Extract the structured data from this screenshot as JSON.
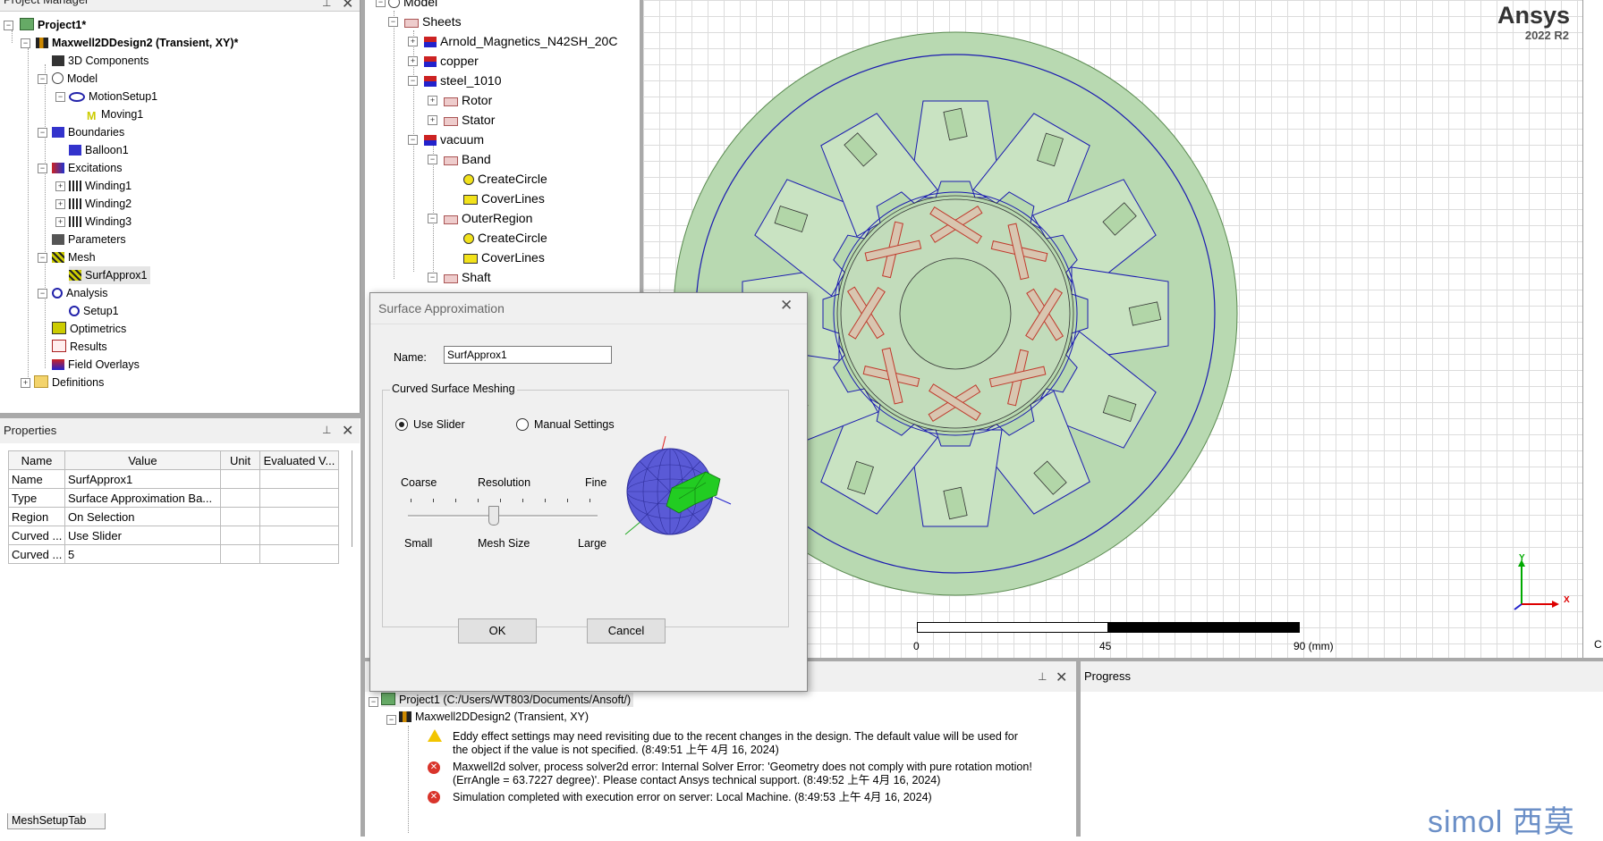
{
  "project_manager": {
    "title": "Project Manager",
    "items": [
      {
        "label": "Project1*",
        "bold": true
      },
      {
        "label": "Maxwell2DDesign2 (Transient, XY)*",
        "bold": true
      },
      {
        "label": "3D Components"
      },
      {
        "label": "Model"
      },
      {
        "label": "MotionSetup1"
      },
      {
        "label": "Moving1"
      },
      {
        "label": "Boundaries"
      },
      {
        "label": "Balloon1"
      },
      {
        "label": "Excitations"
      },
      {
        "label": "Winding1"
      },
      {
        "label": "Winding2"
      },
      {
        "label": "Winding3"
      },
      {
        "label": "Parameters"
      },
      {
        "label": "Mesh"
      },
      {
        "label": "SurfApprox1"
      },
      {
        "label": "Analysis"
      },
      {
        "label": "Setup1"
      },
      {
        "label": "Optimetrics"
      },
      {
        "label": "Results"
      },
      {
        "label": "Field Overlays"
      },
      {
        "label": "Definitions"
      }
    ]
  },
  "properties": {
    "title": "Properties",
    "headers": [
      "Name",
      "Value",
      "Unit",
      "Evaluated V..."
    ],
    "rows": [
      [
        "Name",
        "SurfApprox1",
        "",
        ""
      ],
      [
        "Type",
        "Surface Approximation Ba...",
        "",
        ""
      ],
      [
        "Region",
        "On Selection",
        "",
        ""
      ],
      [
        "Curved ...",
        "Use Slider",
        "",
        ""
      ],
      [
        "Curved ...",
        "5",
        "",
        ""
      ]
    ],
    "tab": "MeshSetupTab"
  },
  "model_tree": {
    "items": [
      {
        "label": "Model"
      },
      {
        "label": "Sheets"
      },
      {
        "label": "Arnold_Magnetics_N42SH_20C"
      },
      {
        "label": "copper"
      },
      {
        "label": "steel_1010"
      },
      {
        "label": "Rotor"
      },
      {
        "label": "Stator"
      },
      {
        "label": "vacuum"
      },
      {
        "label": "Band"
      },
      {
        "label": "CreateCircle"
      },
      {
        "label": "CoverLines"
      },
      {
        "label": "OuterRegion"
      },
      {
        "label": "CreateCircle"
      },
      {
        "label": "CoverLines"
      },
      {
        "label": "Shaft"
      }
    ]
  },
  "viewport": {
    "brand": "Ansys",
    "version": "2022 R2",
    "scale_labels": [
      "0",
      "45",
      "90 (mm)"
    ],
    "axis_y": "Y",
    "axis_x": "X",
    "right_edge_text": "C"
  },
  "dialog": {
    "title": "Surface Approximation",
    "name_label": "Name:",
    "name_value": "SurfApprox1",
    "group_label": "Curved Surface Meshing",
    "radio_slider": "Use Slider",
    "radio_manual": "Manual Settings",
    "selected": "slider",
    "coarse": "Coarse",
    "resolution": "Resolution",
    "fine": "Fine",
    "small": "Small",
    "mesh_size": "Mesh Size",
    "large": "Large",
    "slider_position": 0.45,
    "ok": "OK",
    "cancel": "Cancel"
  },
  "messages": {
    "project": "Project1 (C:/Users/WT803/Documents/Ansoft/)",
    "design": "Maxwell2DDesign2 (Transient, XY)",
    "items": [
      {
        "type": "warning",
        "lines": [
          "Eddy effect settings may need revisiting due to the recent changes in the design.  The default value will be used for",
          "the object if the value is not specified.  (8:49:51 上午  4月 16, 2024)"
        ]
      },
      {
        "type": "error",
        "lines": [
          "Maxwell2d solver, process solver2d error: Internal Solver Error: 'Geometry does not comply with pure rotation motion!",
          "(ErrAngle = 63.7227 degree)'. Please contact Ansys technical support. (8:49:52 上午  4月 16, 2024)"
        ]
      },
      {
        "type": "error",
        "lines": [
          "Simulation completed with execution error on server: Local Machine. (8:49:53 上午  4月 16, 2024)"
        ]
      }
    ]
  },
  "progress": {
    "title": "Progress"
  },
  "watermark": "simol 西莫",
  "colors": {
    "motor_fill": "#b8d9b1",
    "line_blue": "#1a1ab0",
    "magnet": "#c0392b",
    "accent": "#0078d7"
  }
}
